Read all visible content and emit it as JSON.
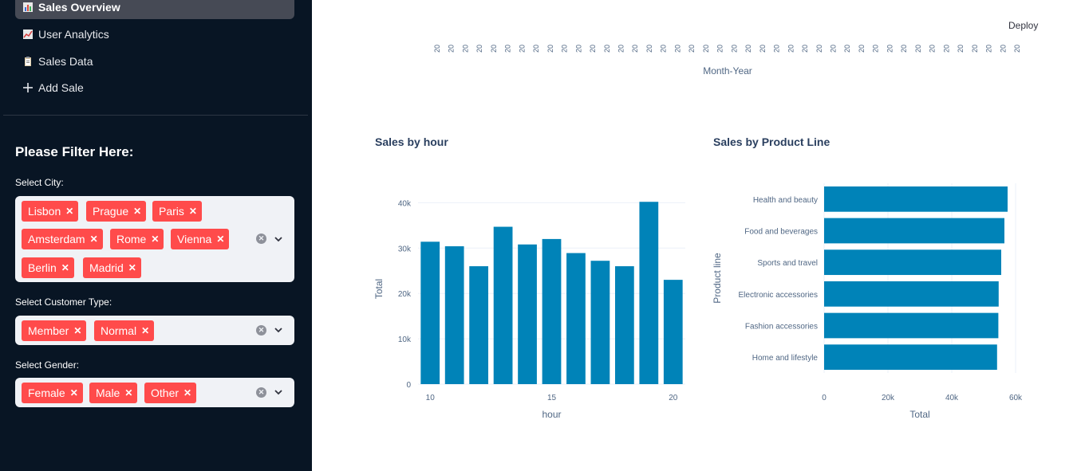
{
  "toolbar": {
    "deploy_label": "Deploy"
  },
  "sidebar": {
    "nav": [
      {
        "label": "Sales Overview",
        "icon": "bar-chart-emoji-icon",
        "active": true
      },
      {
        "label": "User Analytics",
        "icon": "line-chart-emoji-icon",
        "active": false
      },
      {
        "label": "Sales Data",
        "icon": "clipboard-emoji-icon",
        "active": false
      },
      {
        "label": "Add Sale",
        "icon": "plus-icon",
        "active": false
      }
    ],
    "filter_title": "Please Filter Here:",
    "city": {
      "label": "Select City:",
      "tags": [
        "Lisbon",
        "Prague",
        "Paris",
        "Amsterdam",
        "Rome",
        "Vienna",
        "Berlin",
        "Madrid"
      ]
    },
    "customer_type": {
      "label": "Select Customer Type:",
      "tags": [
        "Member",
        "Normal"
      ]
    },
    "gender": {
      "label": "Select Gender:",
      "tags": [
        "Female",
        "Male",
        "Other"
      ]
    }
  },
  "month_chart": {
    "tick_label": "20",
    "tick_count": 42,
    "xlabel": "Month-Year"
  },
  "colors": {
    "bar": "#0083b8",
    "tag": "#ff4b4b",
    "sidebar": "#081524"
  },
  "chart_data": [
    {
      "type": "bar",
      "title": "Sales by hour",
      "xlabel": "hour",
      "ylabel": "Total",
      "x": [
        10,
        11,
        12,
        13,
        14,
        15,
        16,
        17,
        18,
        19,
        20
      ],
      "values": [
        31400,
        30400,
        26000,
        34700,
        30800,
        32000,
        28900,
        27200,
        26000,
        40200,
        23000
      ],
      "xticks": [
        "10",
        "15",
        "20"
      ],
      "yticks": [
        "0",
        "10k",
        "20k",
        "30k",
        "40k"
      ],
      "ylim": [
        0,
        42000
      ],
      "grid": true
    },
    {
      "type": "bar",
      "orientation": "horizontal",
      "title": "Sales by Product Line",
      "xlabel": "Total",
      "ylabel": "Product line",
      "categories": [
        "Health and beauty",
        "Food and beverages",
        "Sports and travel",
        "Electronic accessories",
        "Fashion accessories",
        "Home and lifestyle"
      ],
      "values": [
        57500,
        56500,
        55500,
        54700,
        54600,
        54200
      ],
      "xticks": [
        "0",
        "20k",
        "40k",
        "60k"
      ],
      "xlim": [
        0,
        60000
      ],
      "grid": true
    }
  ]
}
